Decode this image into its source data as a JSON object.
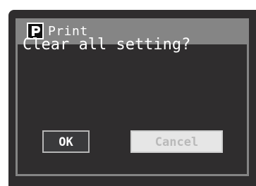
{
  "dialog": {
    "title": "Print",
    "title_icon": "printer-p-icon",
    "message": "Clear all setting?"
  },
  "buttons": {
    "ok_label": "OK",
    "cancel_label": "Cancel",
    "cancel_state": "disabled"
  },
  "colors": {
    "background": "#2f2d2e",
    "dialog_frame": "#858585",
    "text": "#ffffff",
    "cancel_face": "#e6e6e6",
    "cancel_text": "#b9b9b9"
  }
}
